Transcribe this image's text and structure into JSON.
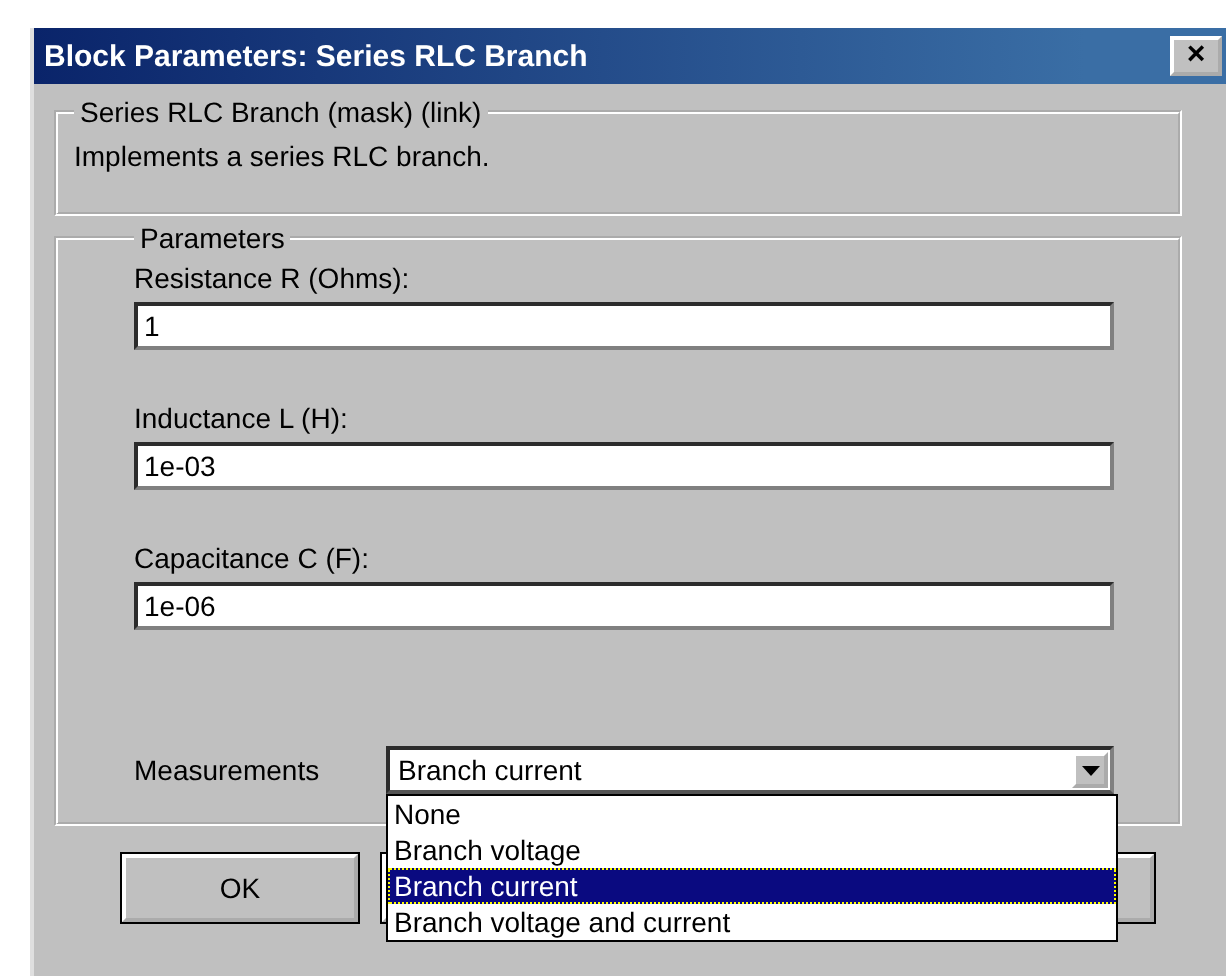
{
  "window": {
    "title": "Block Parameters: Series RLC Branch",
    "close": "×"
  },
  "description_group": {
    "title": "Series RLC Branch (mask) (link)",
    "text": "Implements a series RLC branch."
  },
  "parameters_group": {
    "title": "Parameters",
    "fields": [
      {
        "label": "Resistance R (Ohms):",
        "value": "1"
      },
      {
        "label": "Inductance L (H):",
        "value": "1e-03"
      },
      {
        "label": "Capacitance C (F):",
        "value": "1e-06"
      }
    ],
    "measurements": {
      "label": "Measurements",
      "value": "Branch current",
      "expanded": true,
      "options": [
        {
          "label": "None",
          "selected": false
        },
        {
          "label": "Branch voltage",
          "selected": false
        },
        {
          "label": "Branch current",
          "selected": true
        },
        {
          "label": "Branch voltage and current",
          "selected": false
        }
      ]
    }
  },
  "buttons": [
    "OK"
  ]
}
